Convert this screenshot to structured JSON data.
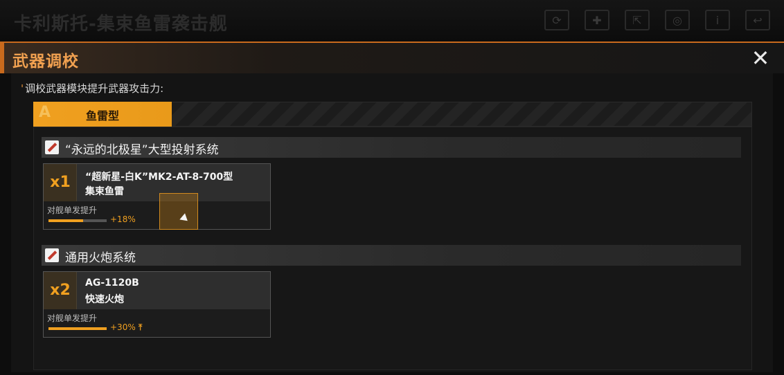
{
  "topbar": {
    "ship_title": "卡利斯托-集束鱼雷袭击舰",
    "icons": [
      "refresh-icon",
      "rank-icon",
      "share-icon",
      "view-icon",
      "info-icon",
      "back-icon"
    ]
  },
  "dialog": {
    "title": "武器调校",
    "close_label": "✕",
    "instruction": "调校武器模块提升武器攻击力:"
  },
  "tab": {
    "letter": "A",
    "label": "鱼雷型"
  },
  "sections": [
    {
      "title": "“永远的北极星”大型投射系统",
      "card": {
        "quantity": "x1",
        "name_line1": "“超新星-白K”MK2-AT-8-700型",
        "name_line2": "集束鱼雷",
        "stat_label": "对舰单发提升",
        "stat_value": "+18%",
        "progress": 0.6
      }
    },
    {
      "title": "通用火炮系统",
      "card": {
        "quantity": "x2",
        "name_line1": "AG-1120B",
        "name_line2": "快速火炮",
        "stat_label": "对舰单发提升",
        "stat_value": "+30%",
        "progress": 1.0
      }
    }
  ],
  "colors": {
    "accent": "#f0a020",
    "title": "#f0a050"
  }
}
